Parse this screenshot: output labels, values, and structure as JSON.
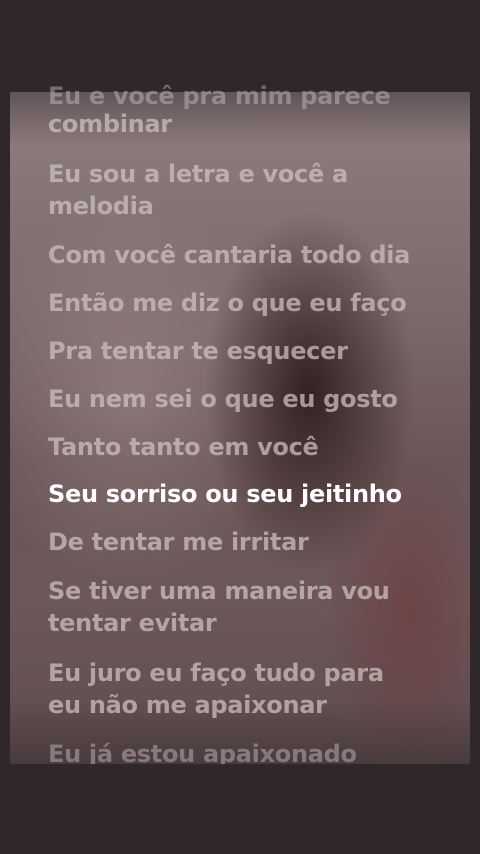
{
  "lyrics": {
    "lines": [
      {
        "text": "Eu e você pra mim parece",
        "state": "partial"
      },
      {
        "text": "combinar",
        "state": "inactive"
      },
      {
        "text": "Eu sou a letra e você a",
        "state": "inactive"
      },
      {
        "text": "melodia",
        "state": "inactive"
      },
      {
        "text": "Com você cantaria todo dia",
        "state": "inactive"
      },
      {
        "text": "Então me diz o que eu faço",
        "state": "inactive"
      },
      {
        "text": "Pra tentar te esquecer",
        "state": "inactive"
      },
      {
        "text": "Eu nem sei o que eu gosto",
        "state": "inactive"
      },
      {
        "text": "Tanto tanto em você",
        "state": "inactive"
      },
      {
        "text": "Seu sorriso ou seu jeitinho",
        "state": "active"
      },
      {
        "text": "De tentar me irritar",
        "state": "inactive"
      },
      {
        "text": "Se tiver uma maneira vou",
        "state": "inactive"
      },
      {
        "text": "tentar evitar",
        "state": "inactive"
      },
      {
        "text": "Eu juro eu faço tudo para",
        "state": "inactive"
      },
      {
        "text": "eu não me apaixonar",
        "state": "inactive"
      },
      {
        "text": "Eu já estou apaixonado",
        "state": "partial"
      }
    ]
  }
}
